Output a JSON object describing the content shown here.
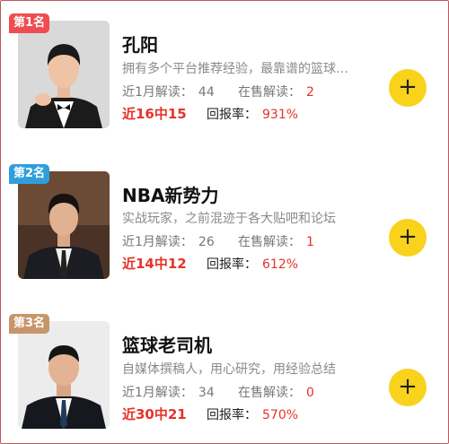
{
  "colors": {
    "accent_red": "#e5332a",
    "follow_yellow": "#f9d21c",
    "rank1": "#ef4d51",
    "rank2": "#2f9fdc",
    "rank3": "#c7956a"
  },
  "experts": [
    {
      "rank": "第1名",
      "name": "孔阳",
      "desc": "拥有多个平台推荐经验，最靠谱的篮球专家",
      "reads_label": "近1月解读：",
      "reads": "44",
      "onsale_label": "在售解读：",
      "onsale": "2",
      "streak": "近16中15",
      "roi_label": "回报率：",
      "roi": "931%",
      "follow_icon": "plus-icon",
      "follow_symbol": "+"
    },
    {
      "rank": "第2名",
      "name": "NBA新势力",
      "desc": "实战玩家，之前混迹于各大贴吧和论坛",
      "reads_label": "近1月解读：",
      "reads": "26",
      "onsale_label": "在售解读：",
      "onsale": "1",
      "streak": "近14中12",
      "roi_label": "回报率：",
      "roi": "612%",
      "follow_icon": "plus-icon",
      "follow_symbol": "+"
    },
    {
      "rank": "第3名",
      "name": "篮球老司机",
      "desc": "自媒体撰稿人，用心研究，用经验总结",
      "reads_label": "近1月解读：",
      "reads": "34",
      "onsale_label": "在售解读：",
      "onsale": "0",
      "streak": "近30中21",
      "roi_label": "回报率：",
      "roi": "570%",
      "follow_icon": "plus-icon",
      "follow_symbol": "+"
    }
  ]
}
